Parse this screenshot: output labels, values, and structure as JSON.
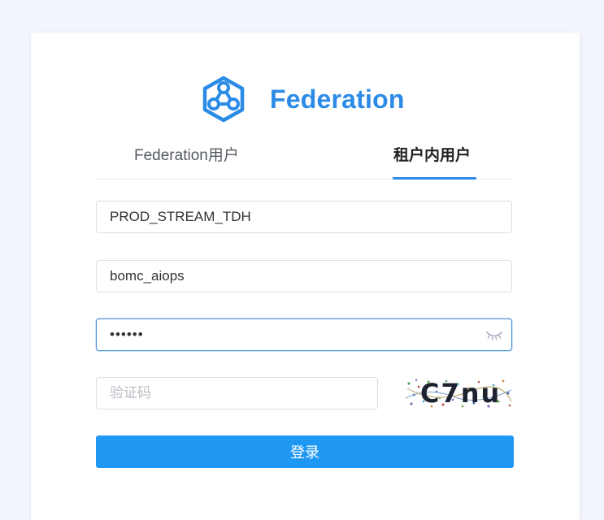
{
  "brand": {
    "name": "Federation",
    "color": "#2b8be6",
    "logo_icon": "network-hexagon-icon"
  },
  "tabs": [
    {
      "label": "Federation用户",
      "active": false
    },
    {
      "label": "租户内用户",
      "active": true
    }
  ],
  "form": {
    "cluster": {
      "value": "PROD_STREAM_TDH"
    },
    "username": {
      "value": "bomc_aiops"
    },
    "password": {
      "value": "••••••",
      "toggle_icon": "eye-closed-icon"
    },
    "captcha": {
      "placeholder": "验证码",
      "image_text": "C7nu"
    },
    "submit_label": "登录"
  },
  "colors": {
    "accent": "#2b8be6",
    "button": "#1f98f4",
    "focus_border": "#4a90d9",
    "background": "#f3f5fc"
  }
}
